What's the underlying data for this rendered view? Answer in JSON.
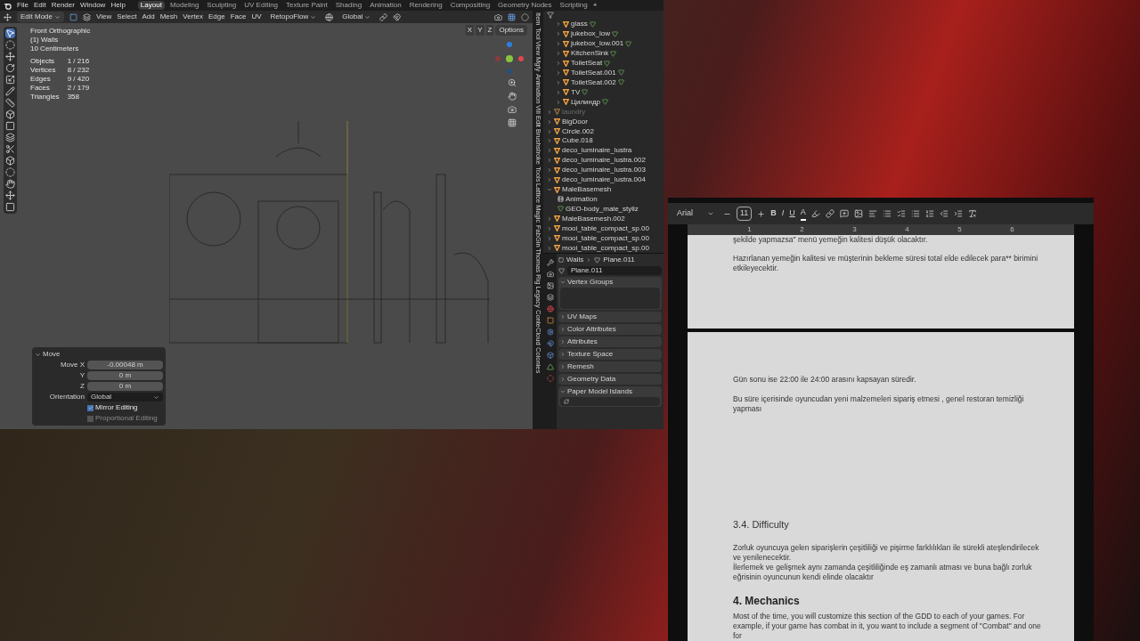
{
  "blender": {
    "menu": [
      "File",
      "Edit",
      "Render",
      "Window",
      "Help"
    ],
    "workspaces": [
      {
        "label": "Layout",
        "selected": true
      },
      {
        "label": "Modeling",
        "selected": false
      },
      {
        "label": "Sculpting",
        "selected": false
      },
      {
        "label": "UV Editing",
        "selected": false
      },
      {
        "label": "Texture Paint",
        "selected": false
      },
      {
        "label": "Shading",
        "selected": false
      },
      {
        "label": "Animation",
        "selected": false
      },
      {
        "label": "Rendering",
        "selected": false
      },
      {
        "label": "Compositing",
        "selected": false
      },
      {
        "label": "Geometry Nodes",
        "selected": false
      },
      {
        "label": "Scripting",
        "selected": false
      }
    ],
    "add_workspace": "+",
    "header": {
      "mode": "Edit Mode",
      "menus": [
        "View",
        "Select",
        "Add",
        "Mesh",
        "Vertex",
        "Edge",
        "Face",
        "UV"
      ],
      "addon": "RetopoFlow",
      "orientation": "Global",
      "axes": [
        "X",
        "Y",
        "Z"
      ],
      "options": "Options"
    },
    "overlay": {
      "view": "Front Orthographic",
      "collection": "(1) Walls",
      "scale": "10 Centimeters",
      "stats": [
        {
          "label": "Objects",
          "value": "1 / 216"
        },
        {
          "label": "Vertices",
          "value": "8 / 232"
        },
        {
          "label": "Edges",
          "value": "9 / 420"
        },
        {
          "label": "Faces",
          "value": "2 / 179"
        },
        {
          "label": "Triangles",
          "value": "358"
        }
      ]
    },
    "operator": {
      "title": "Move",
      "fields": [
        {
          "label": "Move X",
          "value": "-0.00048 m"
        },
        {
          "label": "Y",
          "value": "0 m"
        },
        {
          "label": "Z",
          "value": "0 m"
        }
      ],
      "orientation_label": "Orientation",
      "orientation": "Global",
      "checks": [
        {
          "label": "Mirror Editing",
          "checked": true
        },
        {
          "label": "Proportional Editing",
          "checked": false
        }
      ]
    },
    "sidebar_tabs": [
      "Item",
      "Tool",
      "View",
      "Mgfy",
      "Animation",
      "Vill",
      "Edit",
      "Brushstroke Tools",
      "Lattice Magic",
      "FabGin",
      "Thomas Rig Legacy",
      "ConteCloud",
      "Colonies"
    ],
    "outliner": {
      "inner_items": [
        "glass",
        "jukebox_low",
        "jukebox_low.001",
        "KitchenSink",
        "ToiletSeat",
        "ToiletSeat.001",
        "ToiletSeat.002",
        "TV",
        "Цилиндр"
      ],
      "items": [
        {
          "name": "laundry",
          "disabled": true,
          "expanded": false
        },
        {
          "name": "BigDoor",
          "disabled": false,
          "expanded": false
        },
        {
          "name": "Circle.002",
          "disabled": false,
          "expanded": false
        },
        {
          "name": "Cube.018",
          "disabled": false,
          "expanded": false
        },
        {
          "name": "deco_luminaire_lustra",
          "disabled": false,
          "expanded": false
        },
        {
          "name": "deco_luminaire_lustra.002",
          "disabled": false,
          "expanded": false
        },
        {
          "name": "deco_luminaire_lustra.003",
          "disabled": false,
          "expanded": false
        },
        {
          "name": "deco_luminaire_lustra.004",
          "disabled": false,
          "expanded": false
        },
        {
          "name": "MaleBasemesh",
          "disabled": false,
          "expanded": true,
          "children": [
            {
              "name": "Animation",
              "kind": "animation"
            },
            {
              "name": "GEO-body_male_styliz",
              "kind": "mesh"
            }
          ]
        },
        {
          "name": "MaleBasemesh.002",
          "disabled": false,
          "expanded": false
        },
        {
          "name": "mooi_table_compact_sp.00",
          "disabled": false,
          "expanded": false
        },
        {
          "name": "mooi_table_compact_sp.00",
          "disabled": false,
          "expanded": false
        },
        {
          "name": "mooi_table_compact_sp.00",
          "disabled": false,
          "expanded": false
        }
      ]
    },
    "properties": {
      "breadcrumb": [
        "Walls",
        "Plane.011"
      ],
      "mesh": "Plane.011",
      "panels": [
        {
          "label": "Vertex Groups",
          "expanded": true
        },
        {
          "label": "UV Maps",
          "expanded": false
        },
        {
          "label": "Color Attributes",
          "expanded": false
        },
        {
          "label": "Attributes",
          "expanded": false
        },
        {
          "label": "Texture Space",
          "expanded": false
        },
        {
          "label": "Remesh",
          "expanded": false
        },
        {
          "label": "Geometry Data",
          "expanded": false
        },
        {
          "label": "Paper Model Islands",
          "expanded": true
        }
      ]
    }
  },
  "document": {
    "font": "Arial",
    "font_size": "11",
    "format_buttons": [
      "B",
      "I",
      "U",
      "A"
    ],
    "ruler": [
      "1",
      "2",
      "3",
      "4",
      "5",
      "6"
    ],
    "page1": [
      "şekilde yapmazsa\" menü yemeğin kalitesi düşük olacaktır.",
      "Hazırlanan yemeğin kalitesi ve müşterinin bekleme süresi total elde edilecek para** birimini etkileyecektir."
    ],
    "page2": [
      {
        "kind": "paragraph",
        "text": "Gün sonu ise 22:00 ile 24:00 arasını kapsayan süredir."
      },
      {
        "kind": "paragraph",
        "text": "Bu süre içerisinde oyuncudan yeni malzemeleri sipariş etmesi , genel restoran temizliği yapması"
      },
      {
        "kind": "subheading",
        "text": "3.4. Difficulty"
      },
      {
        "kind": "paragraph",
        "text": "Zorluk oyuncuya gelen siparişlerin çeşitliliği ve pişirme farklılıkları ile sürekli ateşlendirilecek ve yenilenecektir.\nİlerlemek ve gelişmek aynı zamanda çeşitliliğinde eş zamanlı atması ve buna bağlı zorluk eğrisinin oyuncunun kendi elinde olacaktır"
      },
      {
        "kind": "heading",
        "text": "4. Mechanics"
      },
      {
        "kind": "paragraph",
        "text": "Most of the time, you will customize this section of the GDD to each of your games. For example, if your game has combat in it, you want to include a segment of \"Combat\" and one for"
      }
    ]
  }
}
